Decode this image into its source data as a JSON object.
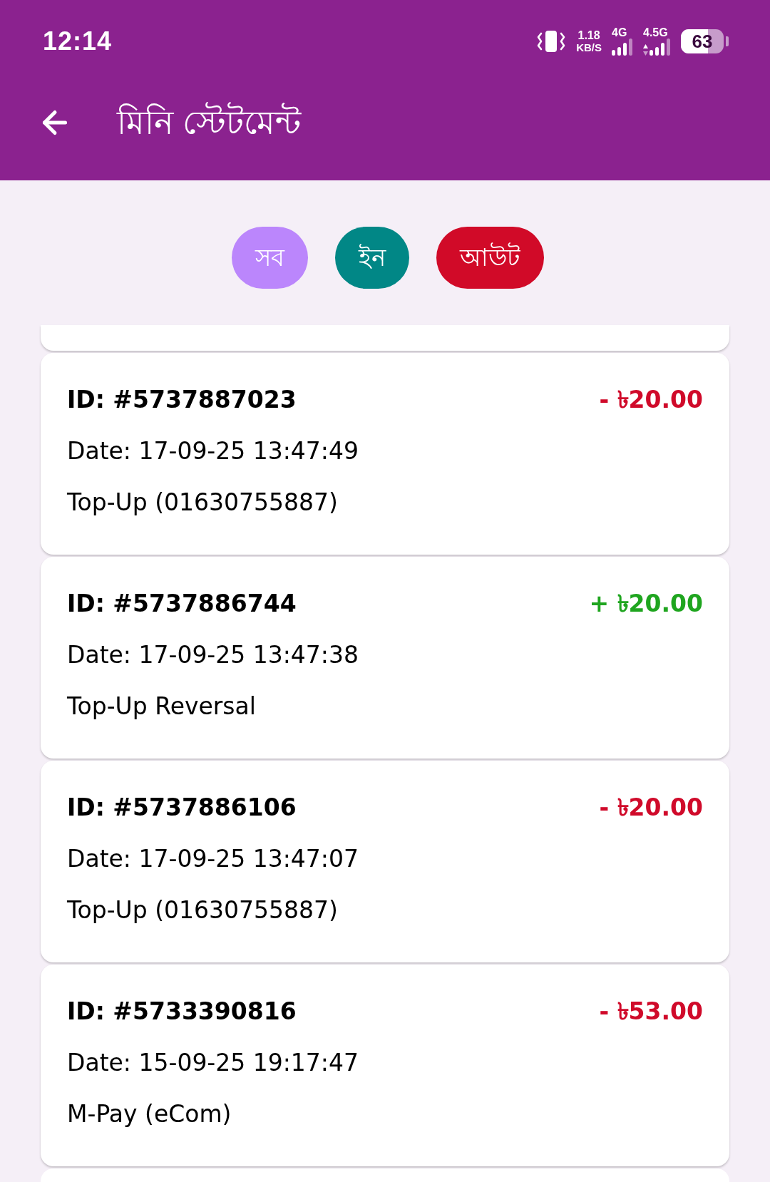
{
  "status_bar": {
    "time": "12:14",
    "network_speed": {
      "value": "1.18",
      "unit": "KB/S"
    },
    "networks": [
      {
        "label": "4G",
        "data_activity": false
      },
      {
        "label": "4.5G",
        "data_activity": true
      }
    ],
    "battery": "63"
  },
  "toolbar": {
    "title": "মিনি স্টেটমেন্ট"
  },
  "filters": [
    {
      "label": "সব",
      "color": "#bb86fc"
    },
    {
      "label": "ইন",
      "color": "#018786"
    },
    {
      "label": "আউট",
      "color": "#d10a28"
    }
  ],
  "transactions": [
    {
      "id": "ID: #5737887023",
      "amount": "- ৳20.00",
      "kind": "debit",
      "date": "Date: 17-09-25 13:47:49",
      "description": "Top-Up (01630755887)"
    },
    {
      "id": "ID: #5737886744",
      "amount": "+ ৳20.00",
      "kind": "credit",
      "date": "Date: 17-09-25 13:47:38",
      "description": "Top-Up Reversal"
    },
    {
      "id": "ID: #5737886106",
      "amount": "- ৳20.00",
      "kind": "debit",
      "date": "Date: 17-09-25 13:47:07",
      "description": "Top-Up (01630755887)"
    },
    {
      "id": "ID: #5733390816",
      "amount": "- ৳53.00",
      "kind": "debit",
      "date": "Date: 15-09-25 19:17:47",
      "description": "M-Pay (eCom)"
    }
  ]
}
